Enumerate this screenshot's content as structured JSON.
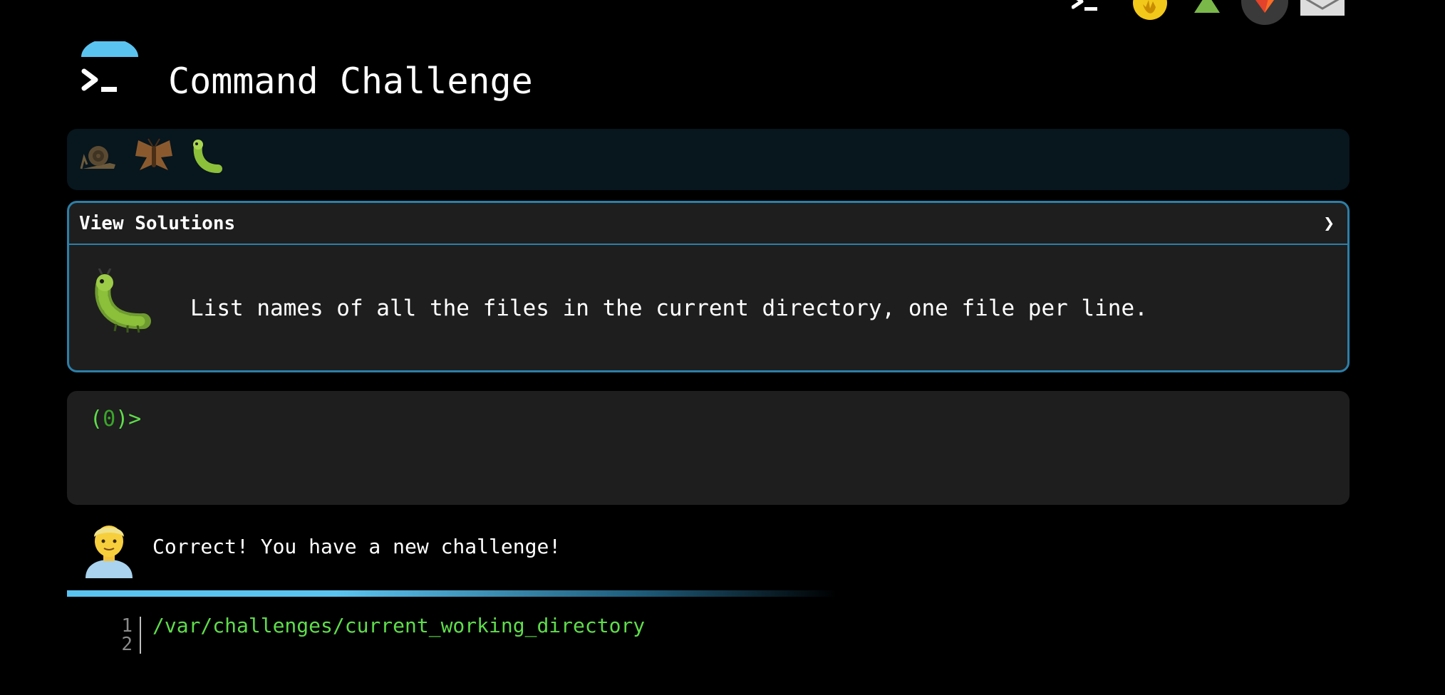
{
  "app": {
    "title": "Command Challenge"
  },
  "top_icons": [
    {
      "name": "terminal-icon"
    },
    {
      "name": "cookie-hand-icon"
    },
    {
      "name": "tree-icon"
    },
    {
      "name": "gitlab-icon"
    },
    {
      "name": "mail-icon"
    }
  ],
  "badges": [
    {
      "name": "snail-badge-icon"
    },
    {
      "name": "moth-badge-icon"
    },
    {
      "name": "caterpillar-badge-icon"
    }
  ],
  "challenge": {
    "view_solutions_label": "View Solutions",
    "chevron": "❯",
    "icon": "caterpillar-icon",
    "task": "List names of all the files in the current directory, one file per line."
  },
  "terminal": {
    "prompt_open": "(",
    "prompt_count": "0",
    "prompt_close": ")>"
  },
  "feedback": {
    "avatar": "man-avatar-icon",
    "message": "Correct! You have a new challenge!"
  },
  "progress": {
    "fraction": 0.6
  },
  "output": {
    "lines": [
      {
        "num": "1",
        "text": "/var/challenges/current_working_directory"
      },
      {
        "num": "2",
        "text": ""
      }
    ]
  },
  "colors": {
    "background": "#000000",
    "panel": "#1e1e1e",
    "panel_border": "#2c7fa8",
    "badge_bar": "#08161e",
    "accent_blue": "#5bc3f0",
    "terminal_green": "#5fdd4b"
  }
}
